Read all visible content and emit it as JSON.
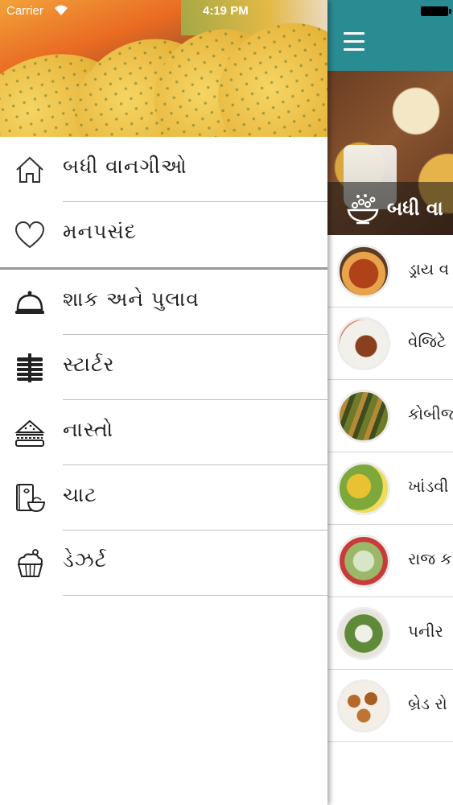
{
  "status_bar": {
    "carrier": "Carrier",
    "time": "4:19 PM"
  },
  "drawer": {
    "primary_items": [
      {
        "label": "બધી વાનગીઓ",
        "icon": "home-icon"
      },
      {
        "label": "મનપસંદ",
        "icon": "heart-icon"
      }
    ],
    "category_items": [
      {
        "label": "શાક અને પુલાવ",
        "icon": "cloche-icon"
      },
      {
        "label": "સ્ટાર્ટર",
        "icon": "sandwich-stack-icon"
      },
      {
        "label": "નાસ્તો",
        "icon": "sandwich-icon"
      },
      {
        "label": "ચાટ",
        "icon": "recipe-book-icon"
      },
      {
        "label": "ડેઝર્ટ",
        "icon": "cupcake-icon"
      }
    ]
  },
  "main": {
    "banner_caption": "બધી વા",
    "list_items": [
      {
        "title": "ડ્રાય વ"
      },
      {
        "title": "વેજિટે"
      },
      {
        "title": "કોબીજ"
      },
      {
        "title": "ખાંડવી"
      },
      {
        "title": "રાજ ક"
      },
      {
        "title": "પનીર"
      },
      {
        "title": "બ્રેડ રો"
      }
    ]
  },
  "colors": {
    "topbar_teal": "#2a8c93",
    "divider": "#bfbfbf"
  }
}
